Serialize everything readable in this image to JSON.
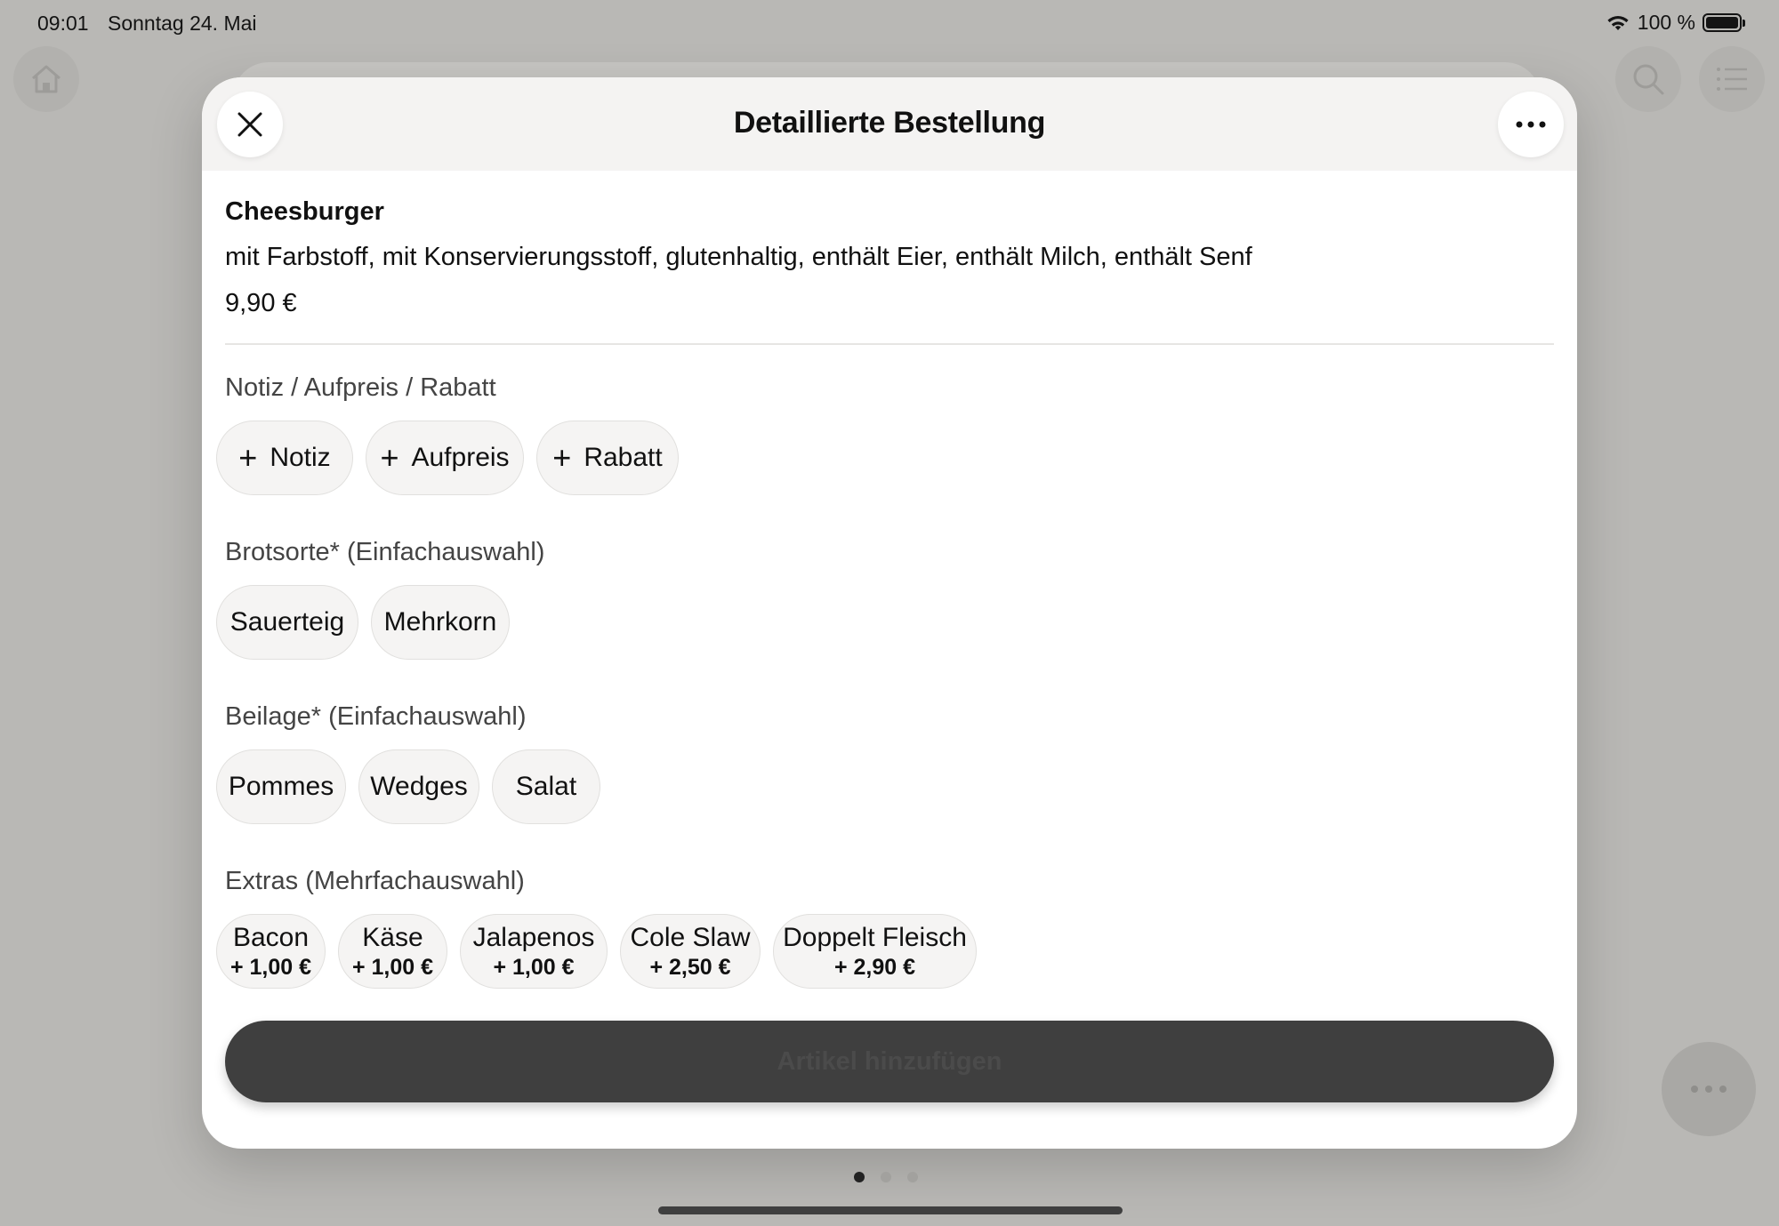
{
  "status_bar": {
    "time": "09:01",
    "date": "Sonntag 24. Mai",
    "battery": "100 %"
  },
  "modal": {
    "title": "Detaillierte Bestellung"
  },
  "product": {
    "name": "Cheesburger",
    "description": "mit Farbstoff, mit Konservierungsstoff, glutenhaltig, enthält Eier, enthält Milch, enthält Senf",
    "price": "9,90 €"
  },
  "sections": {
    "notes": {
      "label": "Notiz / Aufpreis / Rabatt",
      "chips": [
        "Notiz",
        "Aufpreis",
        "Rabatt"
      ]
    },
    "bread": {
      "label": "Brotsorte* (Einfachauswahl)",
      "chips": [
        "Sauerteig",
        "Mehrkorn"
      ]
    },
    "side": {
      "label": "Beilage* (Einfachauswahl)",
      "chips": [
        "Pommes",
        "Wedges",
        "Salat"
      ]
    },
    "extras": {
      "label": "Extras (Mehrfachauswahl)",
      "chips": [
        {
          "name": "Bacon",
          "price": "+ 1,00 €"
        },
        {
          "name": "Käse",
          "price": "+ 1,00 €"
        },
        {
          "name": "Jalapenos",
          "price": "+ 1,00 €"
        },
        {
          "name": "Cole Slaw",
          "price": "+ 2,50 €"
        },
        {
          "name": "Doppelt Fleisch",
          "price": "+ 2,90 €"
        }
      ]
    }
  },
  "add_button": {
    "label": "Artikel hinzufügen"
  },
  "colors": {
    "backdrop": "#b9b8b5",
    "chip_bg": "#f5f4f3",
    "primary_button": "#3f3f3f"
  }
}
